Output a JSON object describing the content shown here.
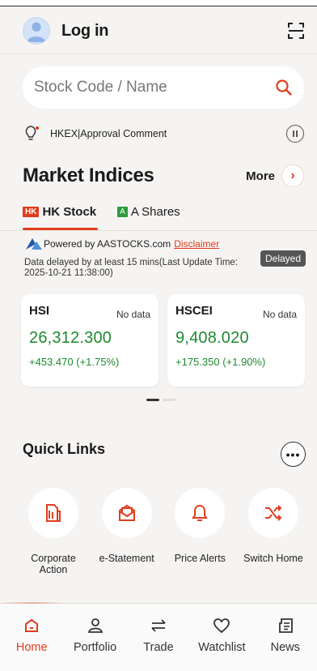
{
  "header": {
    "login_label": "Log in"
  },
  "search": {
    "placeholder": "Stock Code / Name"
  },
  "announcement": {
    "text": "HKEX|Approval Comment"
  },
  "market_indices": {
    "title": "Market Indices",
    "more_label": "More",
    "tabs": [
      {
        "flag": "HK",
        "label": "HK Stock",
        "flag_color": "#e03c1d",
        "active": true
      },
      {
        "flag": "A",
        "label": "A Shares",
        "flag_color": "#2e9b3c",
        "active": false
      }
    ],
    "powered_by": "Powered by AASTOCKS.com",
    "disclaimer": "Disclaimer",
    "delay_note": "Data delayed by at least 15 mins(Last Update Time: 2025-10-21 11:38:00)",
    "delayed_badge": "Delayed",
    "cards": [
      {
        "name": "HSI",
        "status": "No data",
        "price": "26,312.300",
        "change": "+453.470 (+1.75%)"
      },
      {
        "name": "HSCEI",
        "status": "No data",
        "price": "9,408.020",
        "change": "+175.350 (+1.90%)"
      }
    ]
  },
  "quick_links": {
    "title": "Quick Links",
    "items": [
      {
        "label": "Corporate Action",
        "icon": "document-icon"
      },
      {
        "label": "e-Statement",
        "icon": "envelope-icon"
      },
      {
        "label": "Price Alerts",
        "icon": "bell-icon"
      },
      {
        "label": "Switch Home",
        "icon": "shuffle-icon"
      }
    ]
  },
  "nav": {
    "items": [
      {
        "label": "Home",
        "icon": "home-icon",
        "active": true
      },
      {
        "label": "Portfolio",
        "icon": "person-icon",
        "active": false
      },
      {
        "label": "Trade",
        "icon": "exchange-icon",
        "active": false
      },
      {
        "label": "Watchlist",
        "icon": "heart-icon",
        "active": false
      },
      {
        "label": "News",
        "icon": "news-icon",
        "active": false
      }
    ]
  },
  "colors": {
    "accent": "#e03c1d",
    "positive": "#1d8a2f",
    "background": "#f6f4f2"
  }
}
